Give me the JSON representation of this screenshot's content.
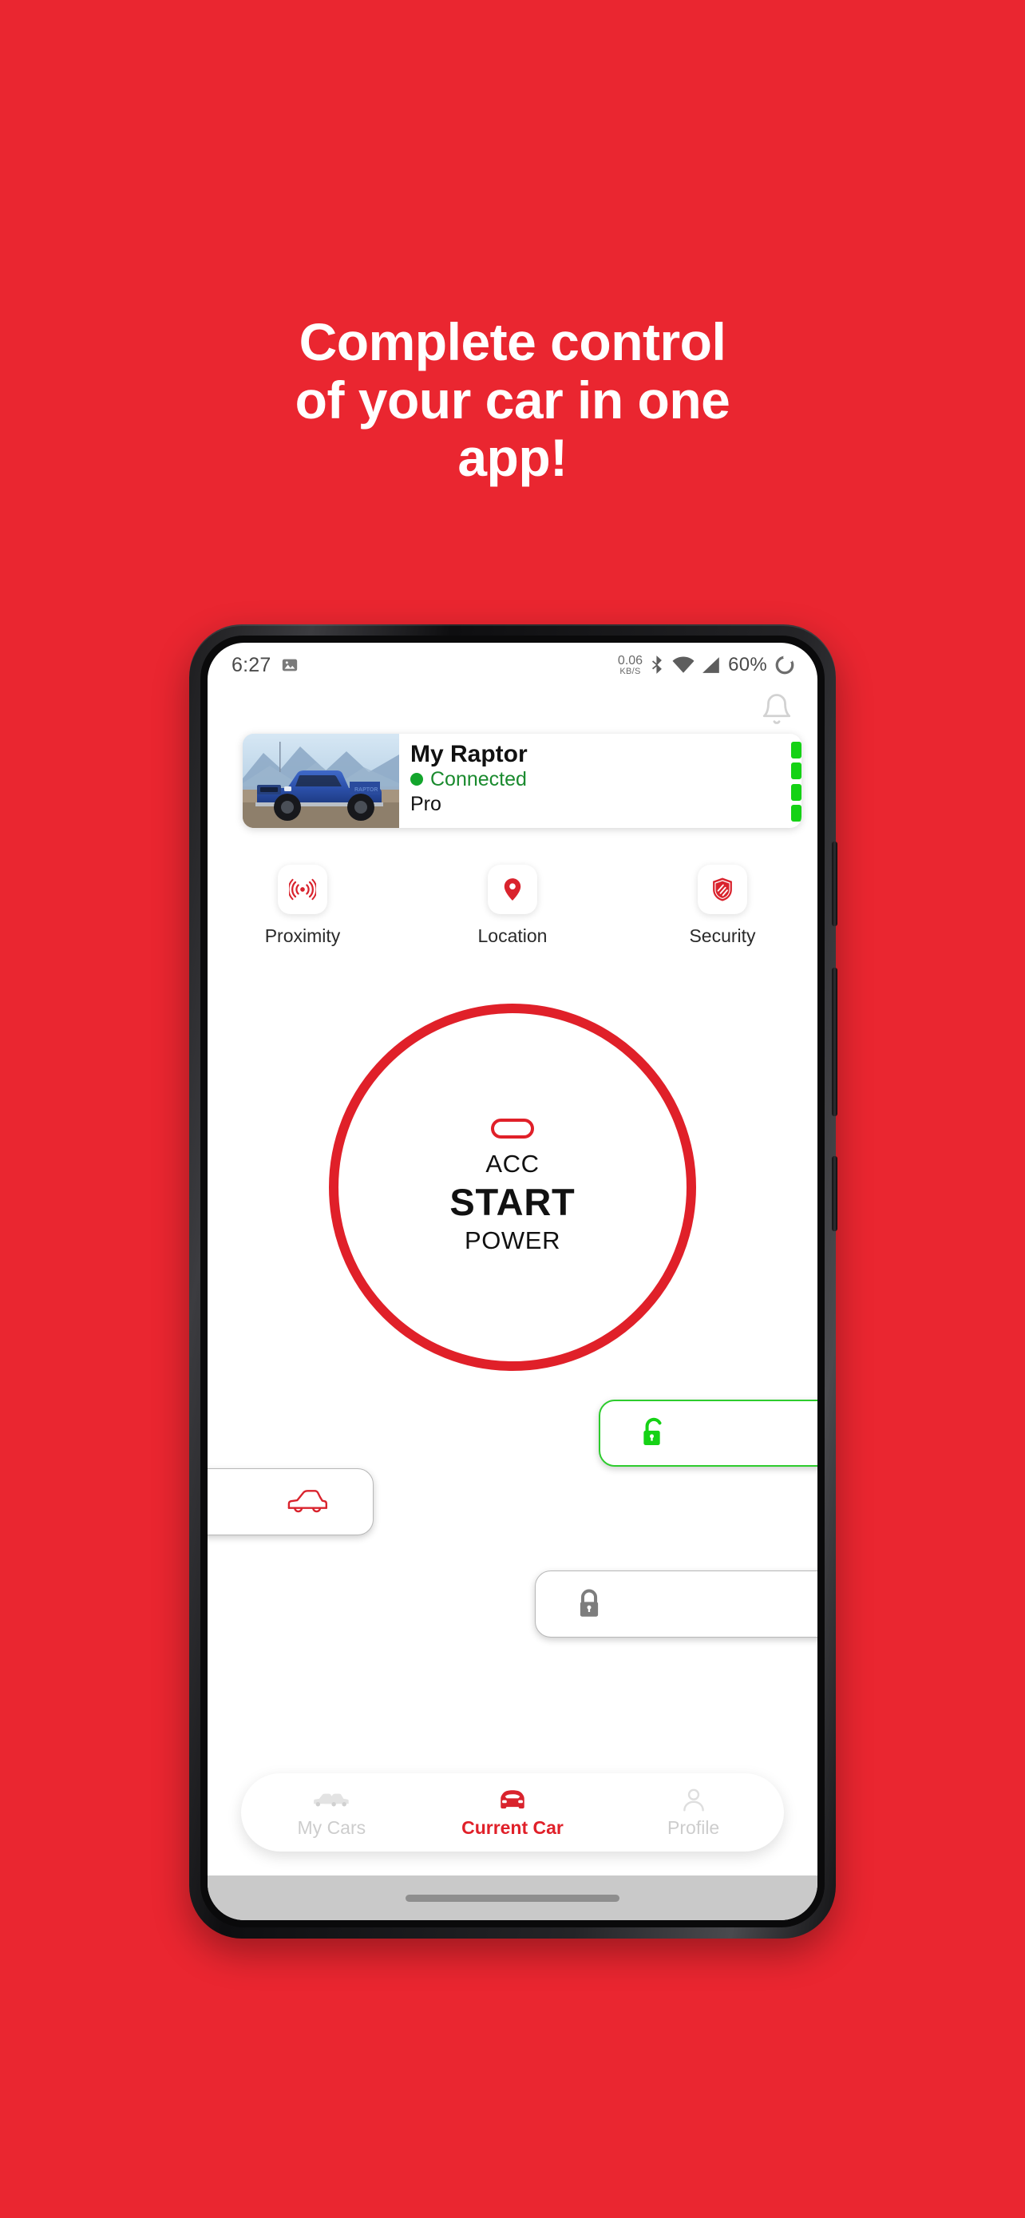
{
  "theme": {
    "background_red": "#EA2630",
    "brand_red": "#E02029",
    "green_connected": "#13a52c",
    "green_unlock": "#2ecc2e",
    "gray_lock": "#7d7d7d"
  },
  "promo": {
    "headline_lines": [
      "Complete control",
      "of your car in one",
      "app!"
    ]
  },
  "phone": {
    "status_bar": {
      "time": "6:27",
      "image_icon": "image-icon",
      "data_rate_value": "0.06",
      "data_rate_unit": "KB/S",
      "bluetooth_icon": "bluetooth-icon",
      "wifi_icon": "wifi-icon",
      "signal_icon": "cellular-signal-icon",
      "battery_percent": "60%",
      "battery_icon": "battery-ring-icon"
    },
    "home_indicator": "home-indicator"
  },
  "app": {
    "header": {
      "notification_icon": "bell-icon"
    },
    "car_card": {
      "photo_alt": "blue-ford-raptor-truck",
      "name": "My Raptor",
      "status": "Connected",
      "status_color": "#1a8a2e",
      "plan": "Pro",
      "signal_bars": 4
    },
    "quick_actions": [
      {
        "icon": "proximity-waves-icon",
        "label": "Proximity"
      },
      {
        "icon": "location-pin-icon",
        "label": "Location"
      },
      {
        "icon": "shield-security-icon",
        "label": "Security"
      }
    ],
    "start_button": {
      "pill_icon": "engine-start-pill-icon",
      "top_label": "ACC",
      "main_label": "START",
      "bottom_label": "POWER"
    },
    "control_buttons": [
      {
        "name": "unlock-button",
        "icon": "unlock-open-icon",
        "color": "#2ecc2e"
      },
      {
        "name": "trunk-button",
        "icon": "car-trunk-icon",
        "color": "#E02029"
      },
      {
        "name": "lock-button",
        "icon": "lock-closed-icon",
        "color": "#7d7d7d"
      }
    ],
    "bottom_nav": [
      {
        "icon": "two-cars-icon",
        "label": "My Cars",
        "active": false
      },
      {
        "icon": "front-car-icon",
        "label": "Current Car",
        "active": true
      },
      {
        "icon": "person-profile-icon",
        "label": "Profile",
        "active": false
      }
    ]
  }
}
